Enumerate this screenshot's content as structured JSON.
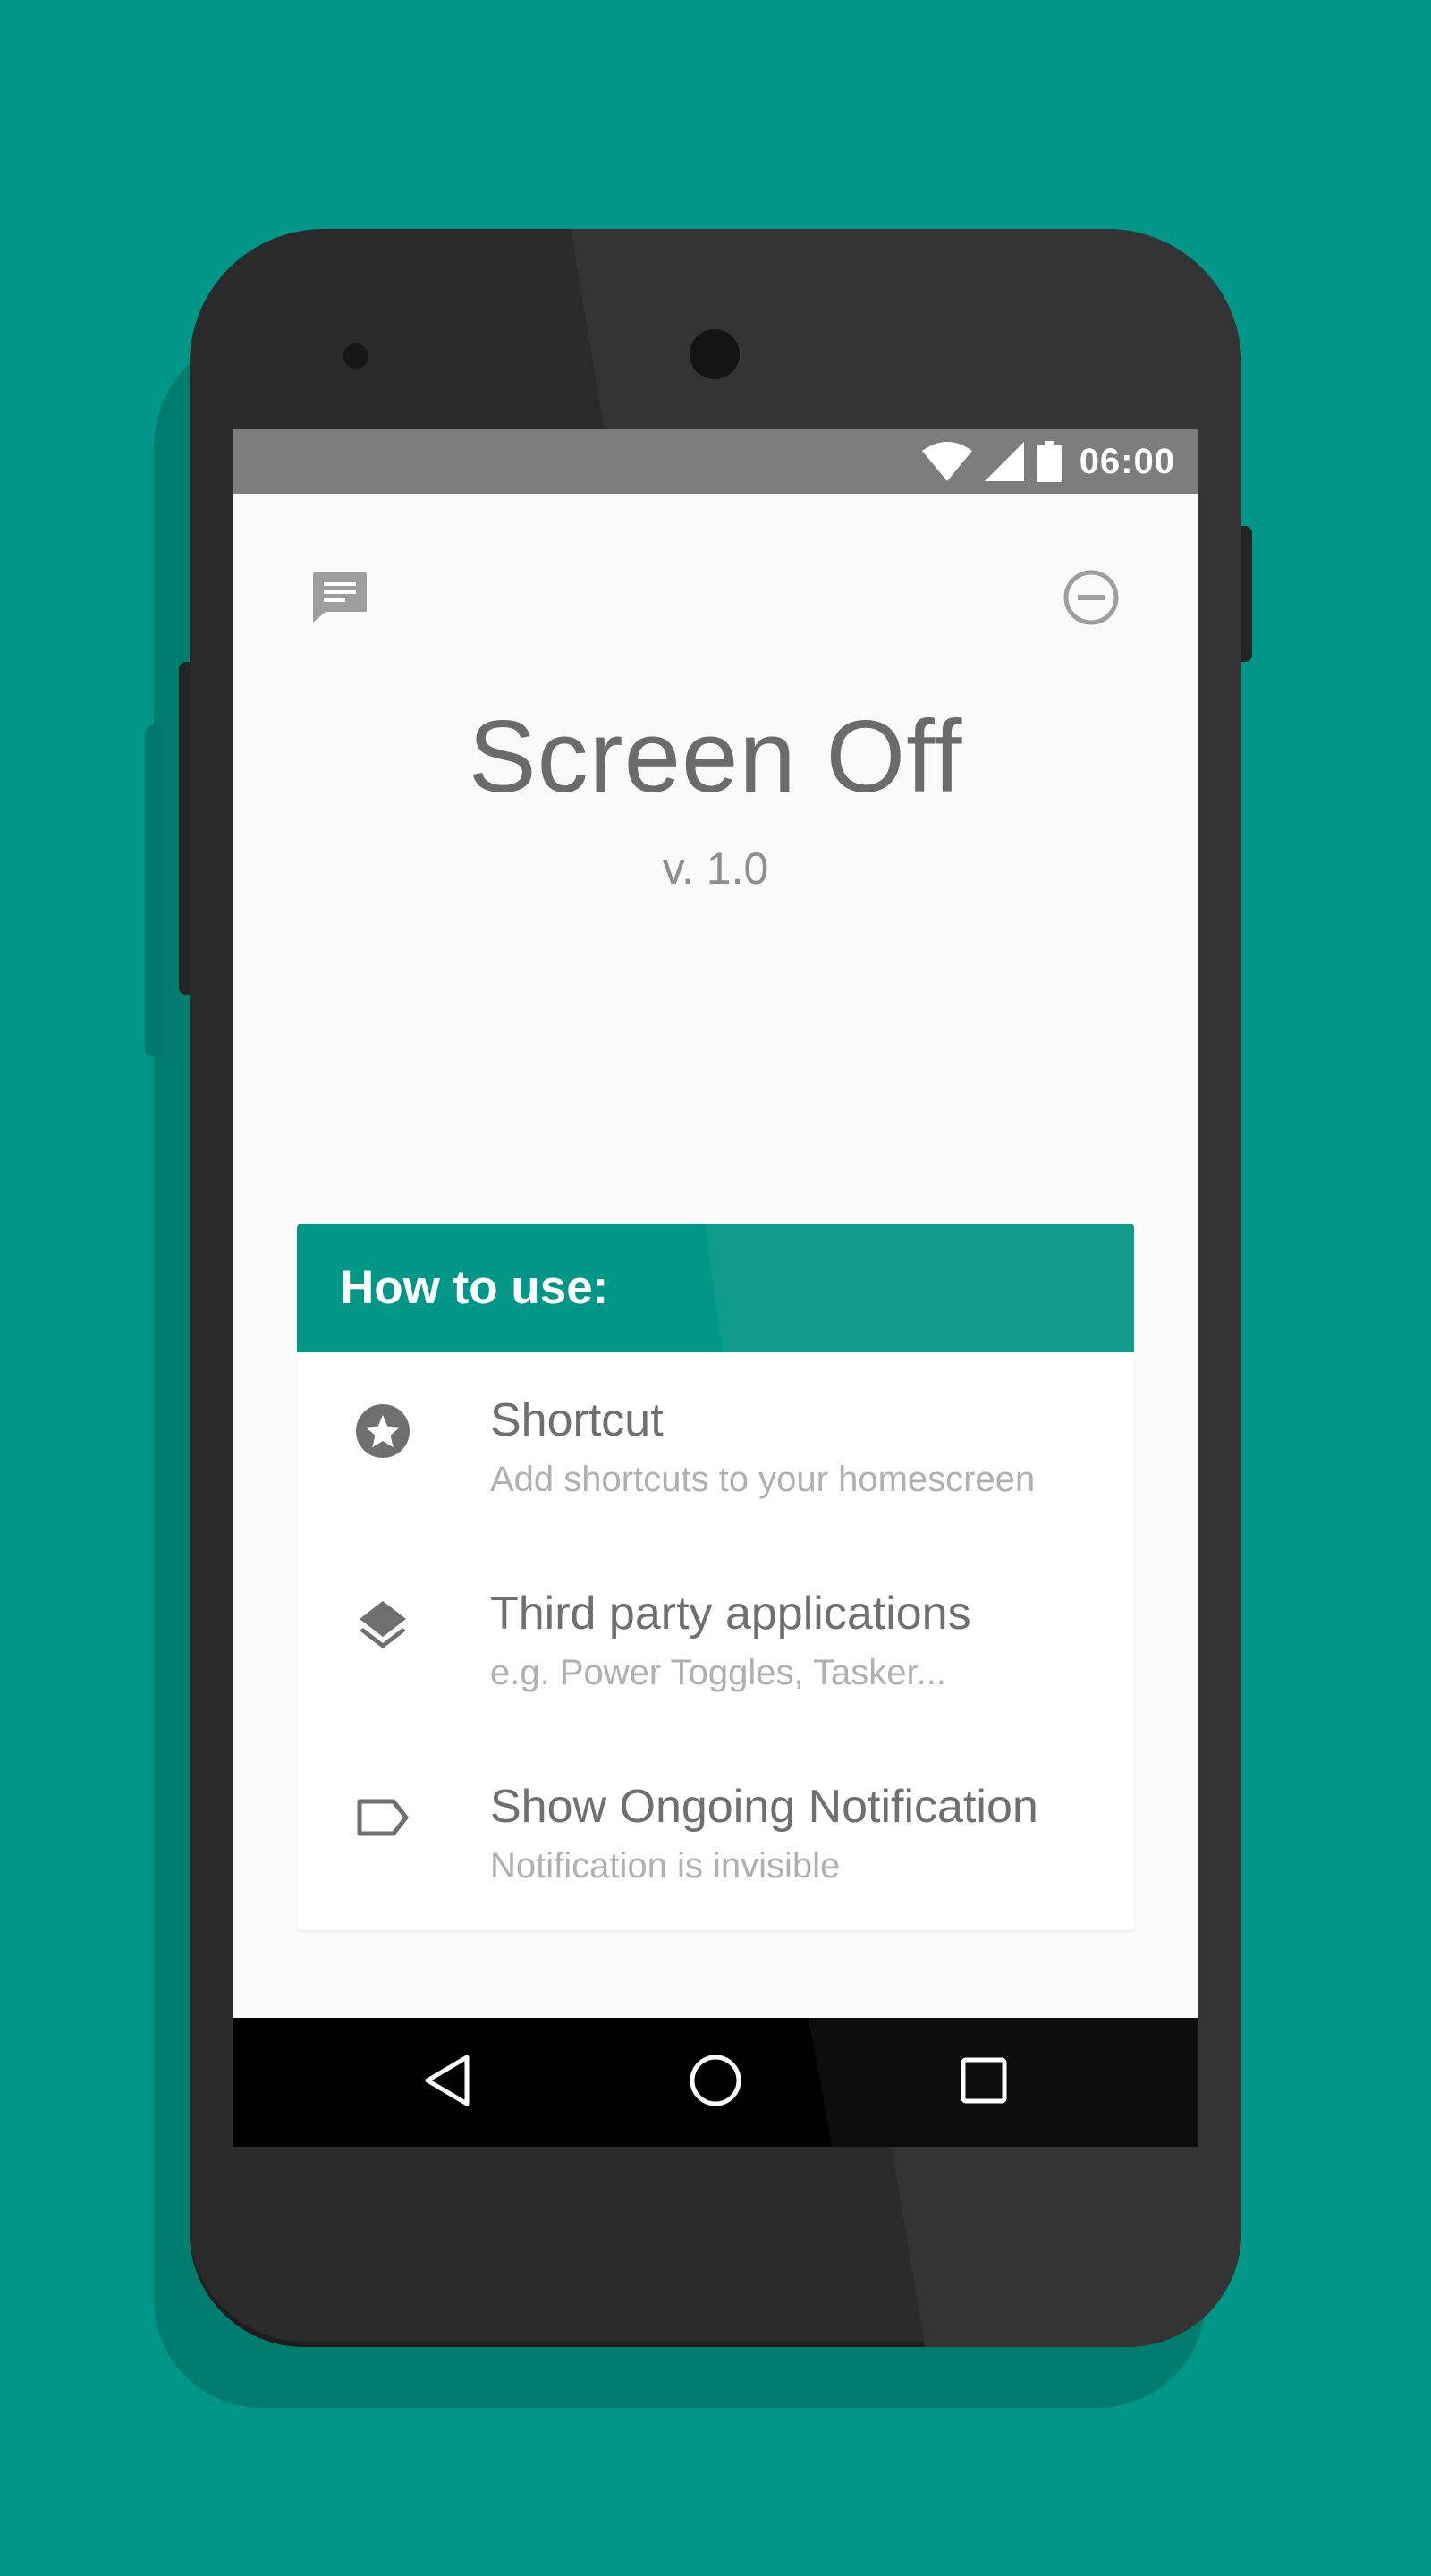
{
  "background": {
    "color": "#009688"
  },
  "status_bar": {
    "time": "06:00",
    "icons": [
      "wifi-icon",
      "cell-signal-icon",
      "battery-icon"
    ]
  },
  "toolbar": {
    "left_icon": "message-icon",
    "right_icon": "minus-circle-icon"
  },
  "app": {
    "title": "Screen Off",
    "version": "v. 1.0"
  },
  "card": {
    "title": "How to use:",
    "accent_color": "#009688",
    "items": [
      {
        "icon": "star-circle-icon",
        "title": "Shortcut",
        "subtitle": "Add shortcuts to your homescreen"
      },
      {
        "icon": "layers-icon",
        "title": "Third party applications",
        "subtitle": "e.g. Power Toggles, Tasker..."
      },
      {
        "icon": "label-outline-icon",
        "title": "Show Ongoing Notification",
        "subtitle": "Notification is invisible"
      }
    ]
  },
  "nav_bar": {
    "icons": [
      "back-icon",
      "home-icon",
      "recents-icon"
    ]
  }
}
